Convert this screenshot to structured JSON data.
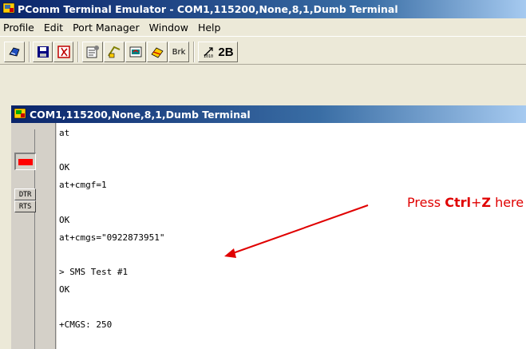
{
  "app": {
    "title": "PComm Terminal Emulator - COM1,115200,None,8,1,Dumb Terminal",
    "icon": "pcomm-app-icon"
  },
  "menu": {
    "items": [
      "Profile",
      "Edit",
      "Port Manager",
      "Window",
      "Help"
    ]
  },
  "toolbar": {
    "brk_label": "Brk",
    "twob_label": "2B",
    "icons": [
      "dial-icon",
      "save-icon",
      "exit-icon",
      "properties-icon",
      "transfer-icon",
      "capture-icon",
      "send-file-icon",
      "break-icon",
      "counter-icon",
      "2b-icon"
    ]
  },
  "terminal_window": {
    "title": "COM1,115200,None,8,1,Dumb Terminal",
    "signals": {
      "led_color": "#ff0000",
      "dtr_label": "DTR",
      "rts_label": "RTS"
    },
    "lines": [
      "at",
      "",
      "OK",
      "at+cmgf=1",
      "",
      "OK",
      "at+cmgs=\"0922873951\"",
      "",
      "> SMS Test #1",
      "OK",
      "",
      "+CMGS: 250"
    ]
  },
  "annotation": {
    "prefix": "Press ",
    "key1": "Ctrl",
    "plus": "+",
    "key2": "Z",
    "suffix": " here",
    "color": "#e00000"
  }
}
